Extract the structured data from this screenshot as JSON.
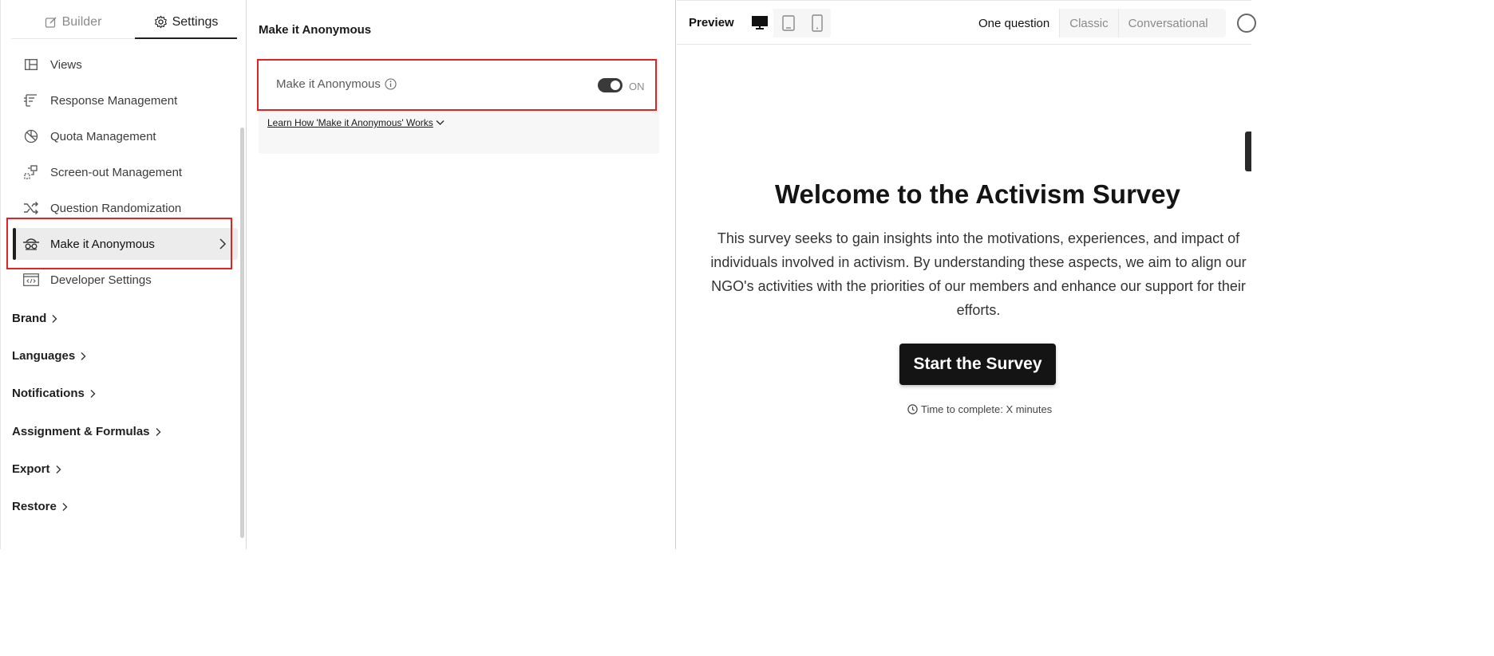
{
  "tabs": {
    "builder": "Builder",
    "settings": "Settings"
  },
  "sidebar": {
    "items": [
      {
        "label": "Views",
        "icon": "table-icon"
      },
      {
        "label": "Response Management",
        "icon": "response-management-icon"
      },
      {
        "label": "Quota Management",
        "icon": "quota-icon"
      },
      {
        "label": "Screen-out Management",
        "icon": "screen-out-icon"
      },
      {
        "label": "Question Randomization",
        "icon": "shuffle-icon"
      },
      {
        "label": "Make it Anonymous",
        "icon": "anonymous-icon",
        "active": true
      },
      {
        "label": "Developer Settings",
        "icon": "code-window-icon"
      }
    ],
    "groups": [
      {
        "label": "Brand"
      },
      {
        "label": "Languages"
      },
      {
        "label": "Notifications"
      },
      {
        "label": "Assignment & Formulas"
      },
      {
        "label": "Export"
      },
      {
        "label": "Restore"
      }
    ]
  },
  "panel": {
    "title": "Make it Anonymous",
    "setting_label": "Make it Anonymous",
    "toggle_state": "ON",
    "learn_link": "Learn How 'Make it Anonymous' Works"
  },
  "preview": {
    "title": "Preview",
    "devices": [
      "desktop-icon",
      "tablet-icon",
      "mobile-icon"
    ],
    "modes": [
      "One question",
      "Classic",
      "Conversational"
    ],
    "welcome_title": "Welcome to the Activism Survey",
    "description": "This survey seeks to gain insights into the motivations, experiences, and impact of individuals involved in activism. By understanding these aspects, we aim to align our NGO's activities with the priorities of our members and enhance our support for their efforts.",
    "start_button": "Start the Survey",
    "time_text": "Time to complete: X minutes"
  },
  "colors": {
    "highlight": "#e02424",
    "accent": "#141414"
  }
}
